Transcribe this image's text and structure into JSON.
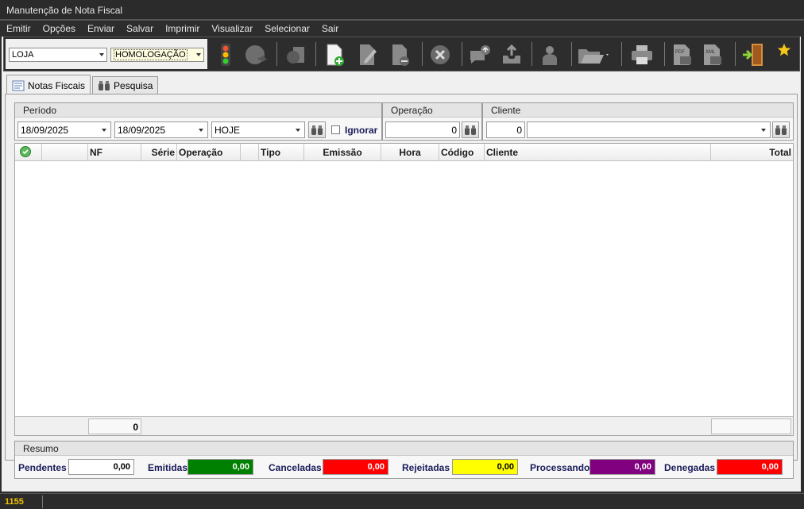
{
  "window": {
    "title": "Manutenção de Nota Fiscal"
  },
  "menu": [
    "Emitir",
    "Opções",
    "Enviar",
    "Salvar",
    "Imprimir",
    "Visualizar",
    "Selecionar",
    "Sair"
  ],
  "toolbar": {
    "loja_value": "LOJA",
    "ambiente_value": "HOMOLOGAÇÃO",
    "icons": [
      "traffic-light-icon",
      "globe-icon",
      "database-icon",
      "new-document-icon",
      "edit-document-icon",
      "remove-document-icon",
      "cancel-icon",
      "send-message-icon",
      "upload-tray-icon",
      "user-icon",
      "open-folder-icon",
      "printer-icon",
      "pdf-icon",
      "xml-icon",
      "exit-door-icon",
      "favorite-star-icon"
    ]
  },
  "tabs": [
    {
      "label": "Notas Fiscais"
    },
    {
      "label": "Pesquisa"
    }
  ],
  "filters": {
    "periodo_label": "Período",
    "operacao_label": "Operação",
    "cliente_label": "Cliente",
    "date_from": "18/09/2025",
    "date_to": "18/09/2025",
    "period_preset": "HOJE",
    "ignorar_label": "Ignorar",
    "operacao_value": "0",
    "cliente_code": "0",
    "cliente_name": ""
  },
  "grid": {
    "columns": [
      "",
      "",
      "NF",
      "Série",
      "Operação",
      "",
      "Tipo",
      "Emissão",
      "Hora",
      "Código",
      "Cliente",
      "Total"
    ],
    "rows": [],
    "footer_count": "0",
    "footer_total": ""
  },
  "resumo": {
    "title": "Resumo",
    "items": [
      {
        "label": "Pendentes",
        "value": "0,00",
        "color": "#ffffff"
      },
      {
        "label": "Emitidas",
        "value": "0,00",
        "color": "#008000"
      },
      {
        "label": "Canceladas",
        "value": "0,00",
        "color": "#ff0000"
      },
      {
        "label": "Rejeitadas",
        "value": "0,00",
        "color": "#ffff00"
      },
      {
        "label": "Processando",
        "value": "0,00",
        "color": "#800080"
      },
      {
        "label": "Denegadas",
        "value": "0,00",
        "color": "#ff0000"
      }
    ]
  },
  "status": {
    "code": "1155"
  }
}
